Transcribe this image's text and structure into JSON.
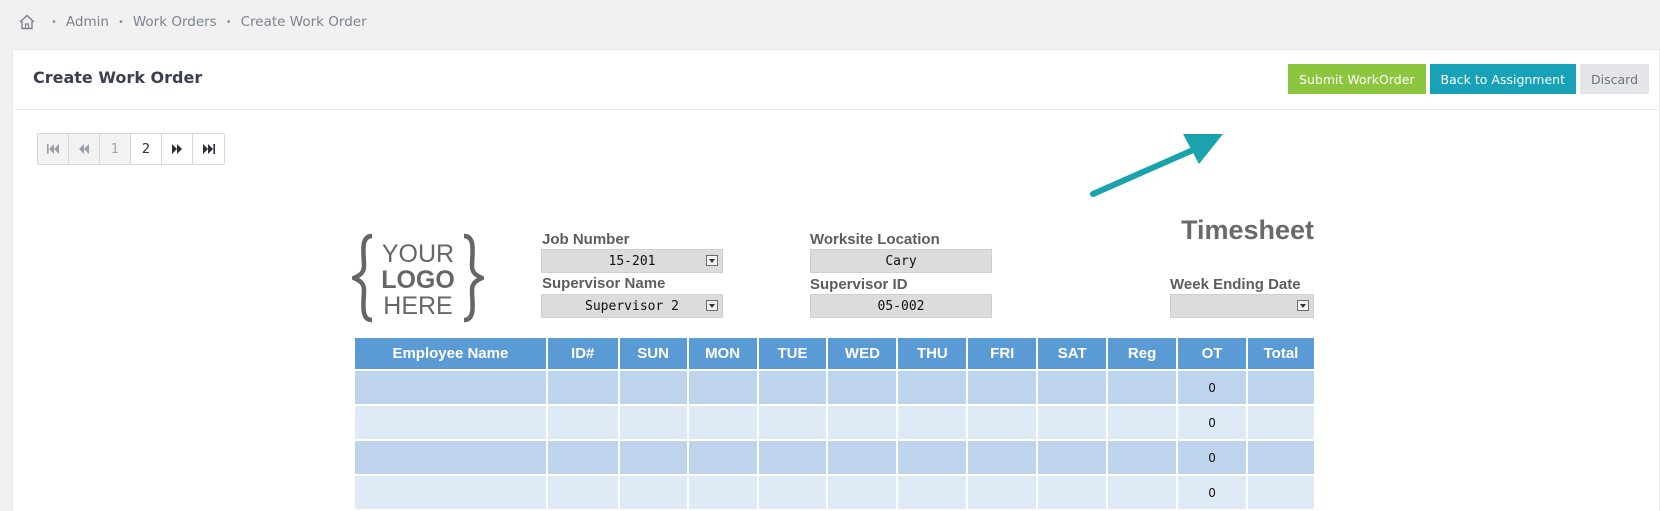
{
  "breadcrumb": {
    "items": [
      "Admin",
      "Work Orders",
      "Create Work Order"
    ]
  },
  "header": {
    "title": "Create Work Order",
    "buttons": {
      "submit": "Submit WorkOrder",
      "back": "Back to Assignment",
      "discard": "Discard"
    }
  },
  "pager": {
    "pages": [
      "1",
      "2"
    ],
    "current_page": "1"
  },
  "timesheet": {
    "title": "Timesheet",
    "logo": {
      "line1": "YOUR",
      "line2": "LOGO",
      "line3": "HERE"
    },
    "fields": {
      "job_number": {
        "label": "Job Number",
        "value": "15-201"
      },
      "supervisor_name": {
        "label": "Supervisor Name",
        "value": "Supervisor 2"
      },
      "worksite_location": {
        "label": "Worksite Location",
        "value": "Cary"
      },
      "supervisor_id": {
        "label": "Supervisor ID",
        "value": "05-002"
      },
      "week_ending_date": {
        "label": "Week Ending Date",
        "value": ""
      }
    },
    "columns": [
      "Employee Name",
      "ID#",
      "SUN",
      "MON",
      "TUE",
      "WED",
      "THU",
      "FRI",
      "SAT",
      "Reg",
      "OT",
      "Total"
    ],
    "rows": [
      [
        "",
        "",
        "",
        "",
        "",
        "",
        "",
        "",
        "",
        "",
        "0",
        ""
      ],
      [
        "",
        "",
        "",
        "",
        "",
        "",
        "",
        "",
        "",
        "",
        "0",
        ""
      ],
      [
        "",
        "",
        "",
        "",
        "",
        "",
        "",
        "",
        "",
        "",
        "0",
        ""
      ],
      [
        "",
        "",
        "",
        "",
        "",
        "",
        "",
        "",
        "",
        "",
        "0",
        ""
      ]
    ]
  },
  "colors": {
    "submit": "#8cc63f",
    "back": "#17a2b8",
    "discard": "#e4e6ea",
    "header_row": "#5b9bd5",
    "row_dark": "#bed3ec",
    "row_light": "#deeaf6",
    "arrow": "#1aa3ad"
  }
}
